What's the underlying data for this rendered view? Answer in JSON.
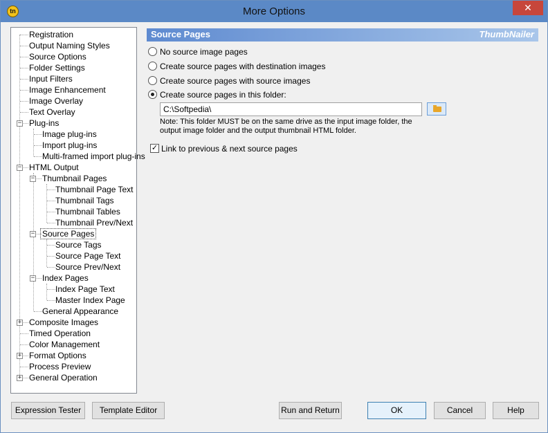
{
  "window": {
    "title": "More Options",
    "app_icon_text": "tn",
    "close_glyph": "✕"
  },
  "tree": {
    "items": [
      {
        "label": "Registration"
      },
      {
        "label": "Output Naming Styles"
      },
      {
        "label": "Source Options"
      },
      {
        "label": "Folder Settings"
      },
      {
        "label": "Input Filters"
      },
      {
        "label": "Image Enhancement"
      },
      {
        "label": "Image Overlay"
      },
      {
        "label": "Text Overlay"
      },
      {
        "label": "Plug-ins"
      },
      {
        "label": "Image plug-ins"
      },
      {
        "label": "Import plug-ins"
      },
      {
        "label": "Multi-framed import plug-ins"
      },
      {
        "label": "HTML Output"
      },
      {
        "label": "Thumbnail Pages"
      },
      {
        "label": "Thumbnail Page Text"
      },
      {
        "label": "Thumbnail Tags"
      },
      {
        "label": "Thumbnail Tables"
      },
      {
        "label": "Thumbnail Prev/Next"
      },
      {
        "label": "Source Pages"
      },
      {
        "label": "Source Tags"
      },
      {
        "label": "Source Page Text"
      },
      {
        "label": "Source Prev/Next"
      },
      {
        "label": "Index Pages"
      },
      {
        "label": "Index Page Text"
      },
      {
        "label": "Master Index Page"
      },
      {
        "label": "General Appearance"
      },
      {
        "label": "Composite Images"
      },
      {
        "label": "Timed Operation"
      },
      {
        "label": "Color Management"
      },
      {
        "label": "Format Options"
      },
      {
        "label": "Process Preview"
      },
      {
        "label": "General Operation"
      }
    ]
  },
  "panel": {
    "title": "Source Pages",
    "brand": "ThumbNailer",
    "options": [
      {
        "label": "No source image pages",
        "checked": false
      },
      {
        "label": "Create source pages with destination images",
        "checked": false
      },
      {
        "label": "Create source pages with source images",
        "checked": false
      },
      {
        "label": "Create source pages in this folder:",
        "checked": true
      }
    ],
    "folder_value": "C:\\Softpedia\\",
    "note": "Note: This folder MUST be on the same drive as the input image folder, the output image folder and the output thumbnail HTML folder.",
    "link_checkbox": {
      "label": "Link to previous & next source pages",
      "checked": true,
      "glyph": "✓"
    }
  },
  "buttons": {
    "expression_tester": "Expression Tester",
    "template_editor": "Template Editor",
    "run_and_return": "Run and Return",
    "ok": "OK",
    "cancel": "Cancel",
    "help": "Help"
  }
}
